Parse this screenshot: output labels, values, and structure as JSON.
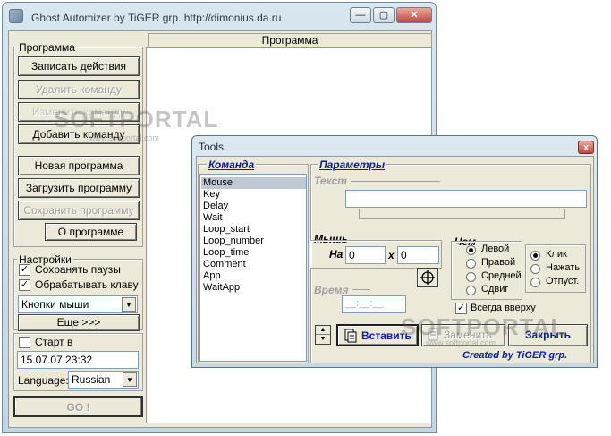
{
  "main_window": {
    "title": "Ghost Automizer by TiGER grp. http://dimonius.da.ru",
    "caption_buttons": {
      "minimize": "—",
      "maximize": "▢",
      "close": "✕"
    },
    "program_group_label": "Программа",
    "buttons": {
      "record": "Записать действия",
      "delete_command": "Удалить команду",
      "hidden_command": "Изменить команду",
      "add_command": "Добавить команду",
      "new_program": "Новая программа",
      "load_program": "Загрузить программу",
      "save_program": "Сохранить программу",
      "about": "О программе"
    },
    "settings": {
      "label": "Настройки",
      "save_pauses": "Сохранять паузы",
      "save_pauses_checked": true,
      "handle_keys": "Обрабатывать клаву",
      "handle_keys_checked": true,
      "mouse_buttons_combo": "Кнопки мыши",
      "more_button": "Еще >>>"
    },
    "start": {
      "label": "Старт в",
      "checked": false,
      "datetime": "15.07.07 23:32",
      "language_label": "Language:",
      "language_value": "Russian",
      "go_button": "GO !"
    },
    "program_panel_header": "Программа"
  },
  "tools_window": {
    "title": "Tools",
    "close": "x",
    "command_label": "Команда",
    "params_label": "Параметры",
    "commands": [
      "Mouse",
      "Key",
      "Delay",
      "Wait",
      "Loop_start",
      "Loop_number",
      "Loop_time",
      "Comment",
      "App",
      "WaitApp"
    ],
    "selected_command": "Mouse",
    "text_label": "Текст",
    "mouse_label": "Мышь",
    "on_label": "На",
    "x_value": "0",
    "x_sep": "x",
    "y_value": "0",
    "time_label": "Время",
    "time_value": "__:__:__",
    "which_label": "Чем",
    "buttons_options": [
      "Левой",
      "Правой",
      "Средней",
      "Сдвиг"
    ],
    "selected_button": "Левой",
    "action_options": [
      "Клик",
      "Нажать",
      "Отпуст."
    ],
    "selected_action": "Клик",
    "always_on_top": "Всегда вверху",
    "always_on_top_checked": true,
    "insert_button": "Вставить",
    "replace_button": "Заменить",
    "close_button": "Закрыть",
    "credit": "Created by TiGER grp."
  },
  "watermarks": {
    "main_text": "SOFTPORTAL",
    "main_url": "www.softportal.com",
    "tools_text": "SOFTPORTAL",
    "tools_url": "www.softportal.com"
  }
}
